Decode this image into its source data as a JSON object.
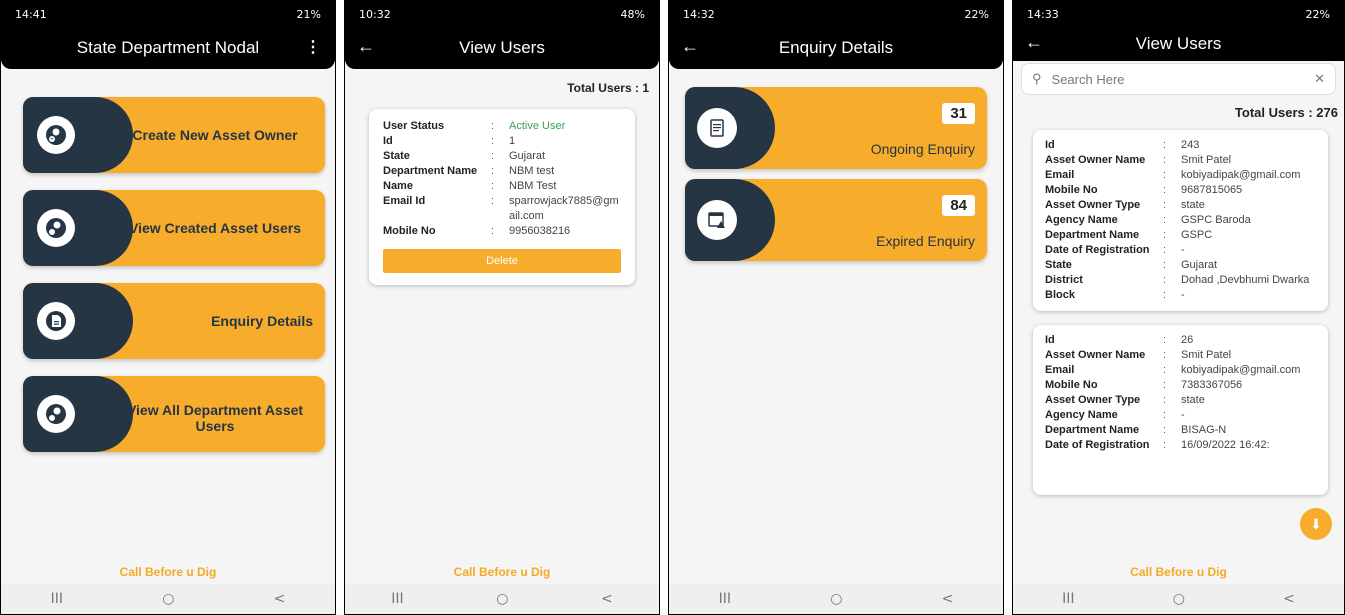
{
  "accent": "#f8ac2b",
  "dark": "#263544",
  "footer_link": "Call Before u Dig",
  "nav": {
    "recents": "III",
    "home": "○",
    "back": "<"
  },
  "screen1": {
    "status": {
      "time": "14:41",
      "right": "21%"
    },
    "title": "State Department Nodal",
    "more": "⋮",
    "items": [
      {
        "label": "Create New Asset Owner",
        "icon": "add-user-icon"
      },
      {
        "label": "View Created Asset Users",
        "icon": "view-user-icon"
      },
      {
        "label": "Enquiry Details",
        "icon": "document-icon"
      },
      {
        "label": "View All Department Asset Users",
        "icon": "view-user-icon"
      }
    ]
  },
  "screen2": {
    "status": {
      "time": "10:32",
      "right": "48%"
    },
    "title": "View Users",
    "total": "Total Users : 1",
    "user": [
      {
        "k": "User Status",
        "v": "Active User"
      },
      {
        "k": "Id",
        "v": "1"
      },
      {
        "k": "State",
        "v": "Gujarat"
      },
      {
        "k": "Department Name",
        "v": "NBM test"
      },
      {
        "k": "Name",
        "v": "NBM Test"
      },
      {
        "k": "Email Id",
        "v": "sparrowjack7885@gmail.com"
      },
      {
        "k": "Mobile No",
        "v": "9956038216"
      }
    ],
    "delete": "Delete"
  },
  "screen3": {
    "status": {
      "time": "14:32",
      "right": "22%"
    },
    "title": "Enquiry Details",
    "cards": [
      {
        "count": "31",
        "label": "Ongoing Enquiry",
        "icon": "report-icon"
      },
      {
        "count": "84",
        "label": "Expired Enquiry",
        "icon": "calendar-warning-icon"
      }
    ]
  },
  "screen4": {
    "status": {
      "time": "14:33",
      "right": "22%"
    },
    "title": "View Users",
    "search_placeholder": "Search Here",
    "total": "Total Users : 276",
    "users": [
      [
        {
          "k": "Id",
          "v": "243"
        },
        {
          "k": "Asset Owner Name",
          "v": "Smit Patel"
        },
        {
          "k": "Email",
          "v": "kobiyadipak@gmail.com"
        },
        {
          "k": "Mobile No",
          "v": "9687815065"
        },
        {
          "k": "Asset Owner Type",
          "v": "state"
        },
        {
          "k": "Agency Name",
          "v": "GSPC Baroda"
        },
        {
          "k": "Department Name",
          "v": "GSPC"
        },
        {
          "k": "Date of Registration",
          "v": "-"
        },
        {
          "k": "State",
          "v": "Gujarat"
        },
        {
          "k": "District",
          "v": "Dohad ,Devbhumi Dwarka"
        },
        {
          "k": "Block",
          "v": "-"
        }
      ],
      [
        {
          "k": "Id",
          "v": "26"
        },
        {
          "k": "Asset Owner Name",
          "v": "Smit Patel"
        },
        {
          "k": "Email",
          "v": "kobiyadipak@gmail.com"
        },
        {
          "k": "Mobile No",
          "v": "7383367056"
        },
        {
          "k": "Asset Owner Type",
          "v": "state"
        },
        {
          "k": "Agency Name",
          "v": "-"
        },
        {
          "k": "Department Name",
          "v": "BISAG-N"
        },
        {
          "k": "Date of Registration",
          "v": "16/09/2022 16:42:"
        }
      ]
    ]
  }
}
